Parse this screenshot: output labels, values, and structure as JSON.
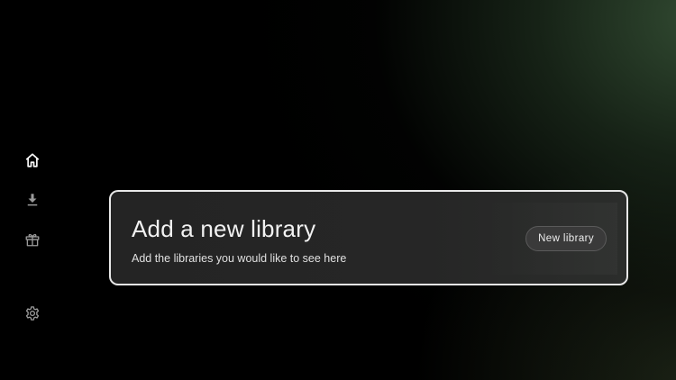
{
  "nav": {
    "items": [
      {
        "icon": "home-icon",
        "selected": true
      },
      {
        "icon": "download-icon",
        "selected": false
      },
      {
        "icon": "gift-icon",
        "selected": false
      },
      {
        "icon": "settings-gear-icon",
        "selected": false
      }
    ]
  },
  "card": {
    "title": "Add a new library",
    "subtitle": "Add the libraries you would like to see here",
    "button_label": "New library"
  },
  "colors": {
    "background": "#000000",
    "accent_glow": "#344e34",
    "card_bg": "#252525",
    "card_border": "#e8e8e8",
    "text": "#f2f2f2"
  }
}
